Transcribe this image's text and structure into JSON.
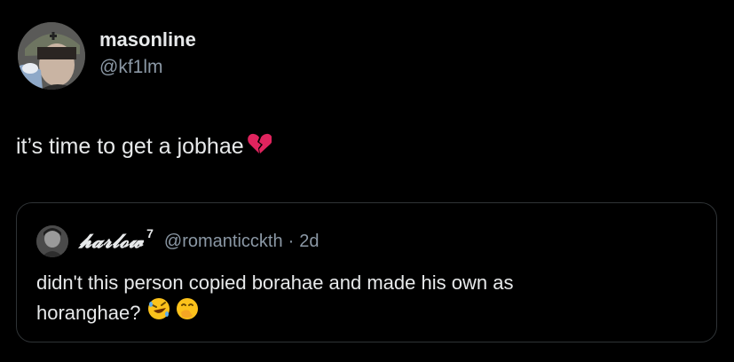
{
  "author": {
    "display_name": "masonline",
    "handle": "@kf1lm"
  },
  "tweet": {
    "text": "it’s time to get a jobhae",
    "emoji": "broken-heart-icon"
  },
  "quoted": {
    "display_name": "𝓱𝓪𝓻𝓵𝓸𝔀",
    "superscript": "7",
    "handle": "@romanticckth",
    "separator": "·",
    "time": "2d",
    "text_line1": "didn't this person copied borahae and made his own as",
    "text_line2": "horanghae?",
    "emojis": [
      "rolling-laughing-icon",
      "hand-over-mouth-icon"
    ]
  },
  "colors": {
    "background": "#000000",
    "text": "#e7e9ea",
    "secondary": "#8b98a5",
    "border": "#2f3336",
    "heart": "#e0245e",
    "emoji_yellow": "#fcc21b"
  }
}
